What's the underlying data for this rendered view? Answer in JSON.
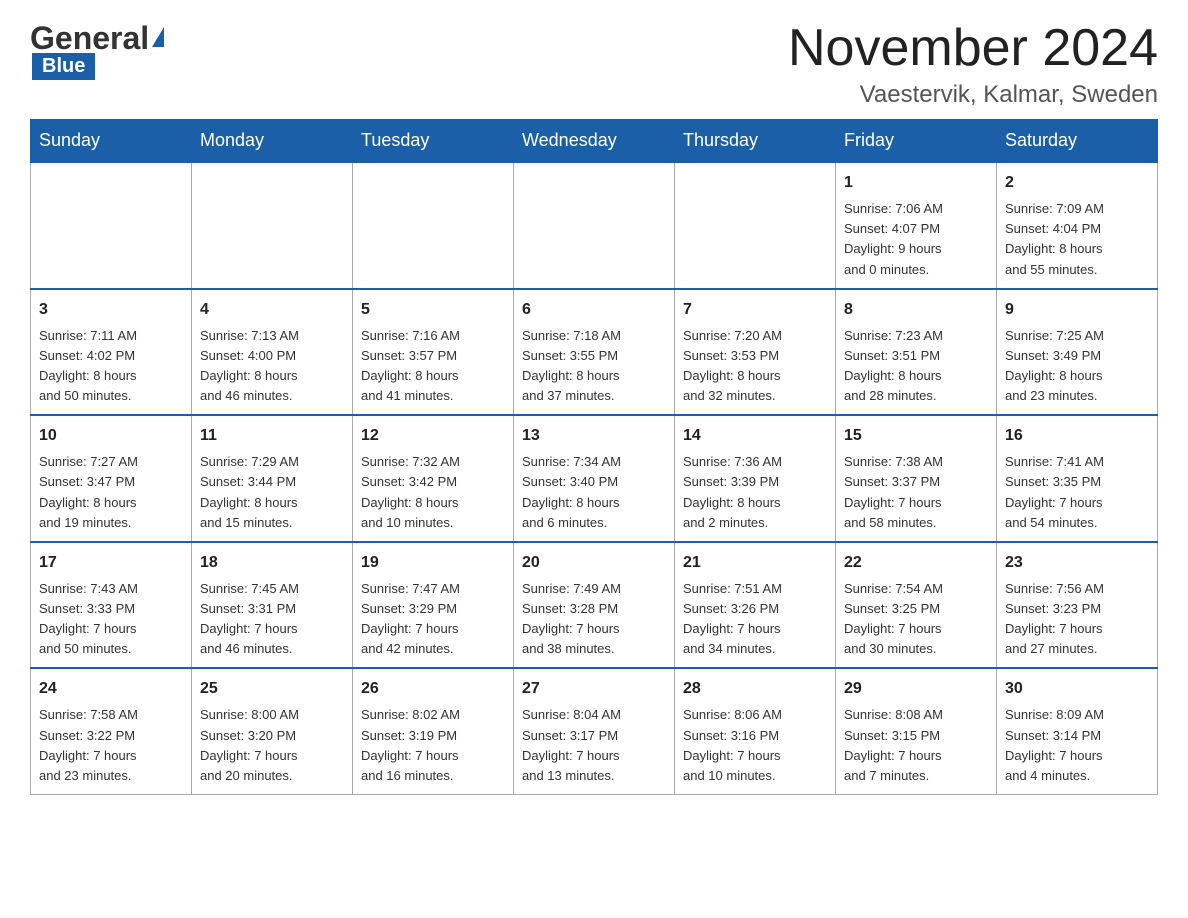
{
  "header": {
    "logo_general": "General",
    "logo_blue": "Blue",
    "month_title": "November 2024",
    "location": "Vaestervik, Kalmar, Sweden"
  },
  "days_of_week": [
    "Sunday",
    "Monday",
    "Tuesday",
    "Wednesday",
    "Thursday",
    "Friday",
    "Saturday"
  ],
  "weeks": [
    [
      {
        "day": "",
        "info": ""
      },
      {
        "day": "",
        "info": ""
      },
      {
        "day": "",
        "info": ""
      },
      {
        "day": "",
        "info": ""
      },
      {
        "day": "",
        "info": ""
      },
      {
        "day": "1",
        "info": "Sunrise: 7:06 AM\nSunset: 4:07 PM\nDaylight: 9 hours\nand 0 minutes."
      },
      {
        "day": "2",
        "info": "Sunrise: 7:09 AM\nSunset: 4:04 PM\nDaylight: 8 hours\nand 55 minutes."
      }
    ],
    [
      {
        "day": "3",
        "info": "Sunrise: 7:11 AM\nSunset: 4:02 PM\nDaylight: 8 hours\nand 50 minutes."
      },
      {
        "day": "4",
        "info": "Sunrise: 7:13 AM\nSunset: 4:00 PM\nDaylight: 8 hours\nand 46 minutes."
      },
      {
        "day": "5",
        "info": "Sunrise: 7:16 AM\nSunset: 3:57 PM\nDaylight: 8 hours\nand 41 minutes."
      },
      {
        "day": "6",
        "info": "Sunrise: 7:18 AM\nSunset: 3:55 PM\nDaylight: 8 hours\nand 37 minutes."
      },
      {
        "day": "7",
        "info": "Sunrise: 7:20 AM\nSunset: 3:53 PM\nDaylight: 8 hours\nand 32 minutes."
      },
      {
        "day": "8",
        "info": "Sunrise: 7:23 AM\nSunset: 3:51 PM\nDaylight: 8 hours\nand 28 minutes."
      },
      {
        "day": "9",
        "info": "Sunrise: 7:25 AM\nSunset: 3:49 PM\nDaylight: 8 hours\nand 23 minutes."
      }
    ],
    [
      {
        "day": "10",
        "info": "Sunrise: 7:27 AM\nSunset: 3:47 PM\nDaylight: 8 hours\nand 19 minutes."
      },
      {
        "day": "11",
        "info": "Sunrise: 7:29 AM\nSunset: 3:44 PM\nDaylight: 8 hours\nand 15 minutes."
      },
      {
        "day": "12",
        "info": "Sunrise: 7:32 AM\nSunset: 3:42 PM\nDaylight: 8 hours\nand 10 minutes."
      },
      {
        "day": "13",
        "info": "Sunrise: 7:34 AM\nSunset: 3:40 PM\nDaylight: 8 hours\nand 6 minutes."
      },
      {
        "day": "14",
        "info": "Sunrise: 7:36 AM\nSunset: 3:39 PM\nDaylight: 8 hours\nand 2 minutes."
      },
      {
        "day": "15",
        "info": "Sunrise: 7:38 AM\nSunset: 3:37 PM\nDaylight: 7 hours\nand 58 minutes."
      },
      {
        "day": "16",
        "info": "Sunrise: 7:41 AM\nSunset: 3:35 PM\nDaylight: 7 hours\nand 54 minutes."
      }
    ],
    [
      {
        "day": "17",
        "info": "Sunrise: 7:43 AM\nSunset: 3:33 PM\nDaylight: 7 hours\nand 50 minutes."
      },
      {
        "day": "18",
        "info": "Sunrise: 7:45 AM\nSunset: 3:31 PM\nDaylight: 7 hours\nand 46 minutes."
      },
      {
        "day": "19",
        "info": "Sunrise: 7:47 AM\nSunset: 3:29 PM\nDaylight: 7 hours\nand 42 minutes."
      },
      {
        "day": "20",
        "info": "Sunrise: 7:49 AM\nSunset: 3:28 PM\nDaylight: 7 hours\nand 38 minutes."
      },
      {
        "day": "21",
        "info": "Sunrise: 7:51 AM\nSunset: 3:26 PM\nDaylight: 7 hours\nand 34 minutes."
      },
      {
        "day": "22",
        "info": "Sunrise: 7:54 AM\nSunset: 3:25 PM\nDaylight: 7 hours\nand 30 minutes."
      },
      {
        "day": "23",
        "info": "Sunrise: 7:56 AM\nSunset: 3:23 PM\nDaylight: 7 hours\nand 27 minutes."
      }
    ],
    [
      {
        "day": "24",
        "info": "Sunrise: 7:58 AM\nSunset: 3:22 PM\nDaylight: 7 hours\nand 23 minutes."
      },
      {
        "day": "25",
        "info": "Sunrise: 8:00 AM\nSunset: 3:20 PM\nDaylight: 7 hours\nand 20 minutes."
      },
      {
        "day": "26",
        "info": "Sunrise: 8:02 AM\nSunset: 3:19 PM\nDaylight: 7 hours\nand 16 minutes."
      },
      {
        "day": "27",
        "info": "Sunrise: 8:04 AM\nSunset: 3:17 PM\nDaylight: 7 hours\nand 13 minutes."
      },
      {
        "day": "28",
        "info": "Sunrise: 8:06 AM\nSunset: 3:16 PM\nDaylight: 7 hours\nand 10 minutes."
      },
      {
        "day": "29",
        "info": "Sunrise: 8:08 AM\nSunset: 3:15 PM\nDaylight: 7 hours\nand 7 minutes."
      },
      {
        "day": "30",
        "info": "Sunrise: 8:09 AM\nSunset: 3:14 PM\nDaylight: 7 hours\nand 4 minutes."
      }
    ]
  ]
}
